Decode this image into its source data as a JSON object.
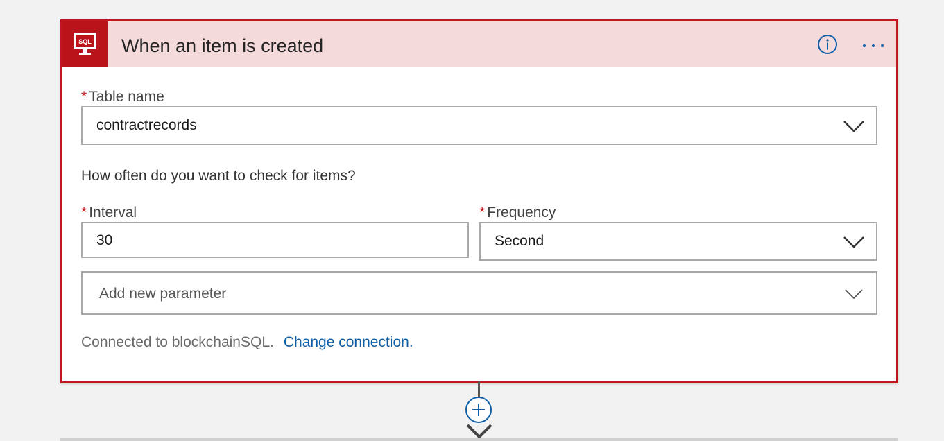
{
  "trigger": {
    "icon": "sql-server-icon",
    "icon_text": "SQL",
    "title": "When an item is created",
    "accent_color": "#c0161f",
    "header_bg": "#f5dadb"
  },
  "table_name": {
    "required_mark": "*",
    "label": "Table name",
    "value": "contractrecords"
  },
  "schedule": {
    "question": "How often do you want to check for items?",
    "interval": {
      "required_mark": "*",
      "label": "Interval",
      "value": "30"
    },
    "frequency": {
      "required_mark": "*",
      "label": "Frequency",
      "value": "Second"
    }
  },
  "add_parameter": {
    "placeholder": "Add new parameter"
  },
  "connection": {
    "text": "Connected to blockchainSQL.",
    "link": "Change connection.",
    "link_color": "#0f5fa8"
  }
}
